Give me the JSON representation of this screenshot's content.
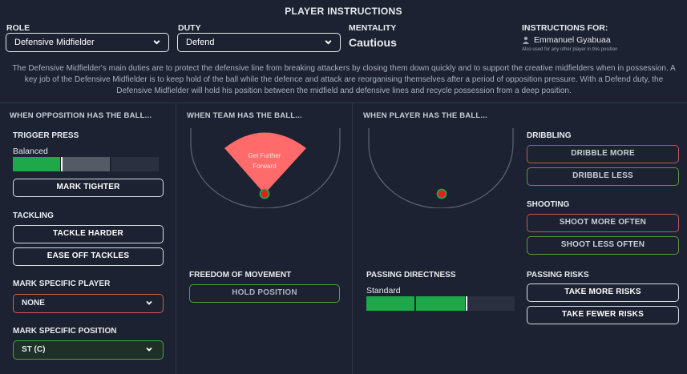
{
  "title": "PLAYER INSTRUCTIONS",
  "role": {
    "label": "ROLE",
    "value": "Defensive Midfielder"
  },
  "duty": {
    "label": "DUTY",
    "value": "Defend"
  },
  "mentality": {
    "label": "MENTALITY",
    "value": "Cautious"
  },
  "instructions_for": {
    "label": "INSTRUCTIONS FOR:",
    "player": "Emmanuel Gyabuaa",
    "note": "Also used for any other player in this position"
  },
  "description": "The Defensive Midfielder's main duties are to protect the defensive line from breaking attackers by closing them down quickly and to support the creative midfielders when in possession. A key job of the Defensive Midfielder is to keep hold of the ball while the defence and attack are reorganising themselves after a period of opposition pressure. With a Defend duty, the Defensive Midfielder will hold his position between the midfield and defensive lines and recycle possession from a deep position.",
  "opposition": {
    "header": "WHEN OPPOSITION HAS THE BALL...",
    "trigger_press": {
      "label": "TRIGGER PRESS",
      "value": "Balanced",
      "level": 0.33
    },
    "mark_tighter": "MARK TIGHTER",
    "tackling": {
      "label": "TACKLING",
      "harder": "TACKLE HARDER",
      "ease_off": "EASE OFF TACKLES"
    },
    "mark_player": {
      "label": "MARK SPECIFIC PLAYER",
      "value": "NONE"
    },
    "mark_position": {
      "label": "MARK SPECIFIC POSITION",
      "value": "ST (C)"
    }
  },
  "team": {
    "header": "WHEN TEAM HAS THE BALL...",
    "zone_label_line1": "Get Further",
    "zone_label_line2": "Forward",
    "freedom": {
      "label": "FREEDOM OF MOVEMENT",
      "button": "HOLD POSITION"
    }
  },
  "player": {
    "header": "WHEN PLAYER HAS THE BALL...",
    "passing_directness": {
      "label": "PASSING DIRECTNESS",
      "value": "Standard",
      "level": 0.67
    },
    "dribbling": {
      "label": "DRIBBLING",
      "more": "DRIBBLE MORE",
      "less": "DRIBBLE LESS"
    },
    "shooting": {
      "label": "SHOOTING",
      "more": "SHOOT MORE OFTEN",
      "less": "SHOOT LESS OFTEN"
    },
    "passing_risks": {
      "label": "PASSING RISKS",
      "more": "TAKE MORE RISKS",
      "fewer": "TAKE FEWER RISKS"
    }
  },
  "colors": {
    "background": "#1c2231",
    "green": "#1fa84a",
    "red_zone": "#ff6b6b",
    "red_border": "#c0575d",
    "green_border": "#5f9a3e"
  },
  "icons": [
    "chevron-down-icon",
    "person-icon"
  ]
}
